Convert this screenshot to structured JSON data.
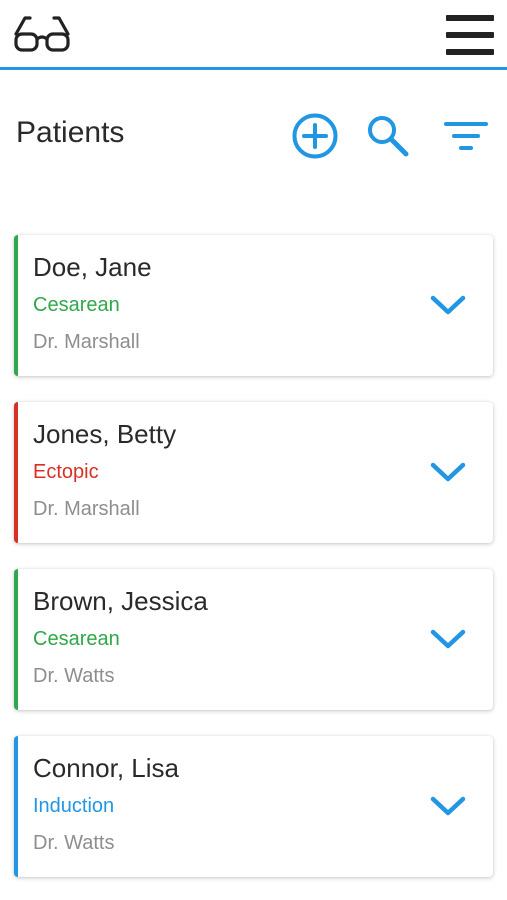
{
  "header": {
    "logo_icon": "glasses-icon",
    "menu_icon": "hamburger-menu-icon"
  },
  "page": {
    "title": "Patients",
    "actions": [
      {
        "icon": "add-circle-icon"
      },
      {
        "icon": "search-icon"
      },
      {
        "icon": "filter-icon"
      }
    ]
  },
  "colors": {
    "accent": "#2196e3",
    "cesarean": "#2ea84a",
    "ectopic": "#d93025",
    "induction": "#2196e3",
    "doctor_text": "#8e8e8e",
    "primary_text": "#2a2a2a"
  },
  "patients": [
    {
      "name": "Doe, Jane",
      "procedure": "Cesarean",
      "procedure_color": "#2ea84a",
      "doctor": "Dr. Marshall"
    },
    {
      "name": "Jones, Betty",
      "procedure": "Ectopic",
      "procedure_color": "#d93025",
      "doctor": "Dr. Marshall"
    },
    {
      "name": "Brown, Jessica",
      "procedure": "Cesarean",
      "procedure_color": "#2ea84a",
      "doctor": "Dr. Watts"
    },
    {
      "name": "Connor, Lisa",
      "procedure": "Induction",
      "procedure_color": "#2196e3",
      "doctor": "Dr. Watts"
    }
  ]
}
